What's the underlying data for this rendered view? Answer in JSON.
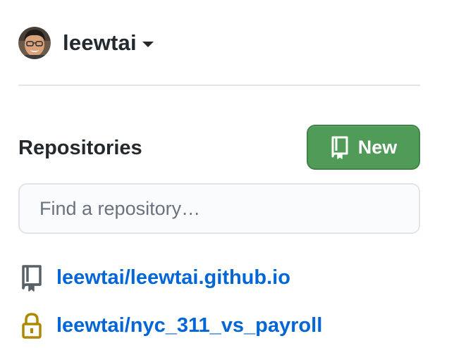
{
  "account": {
    "username": "leewtai",
    "avatar_icon": "user-avatar-photo",
    "dropdown_icon": "caret-down-icon"
  },
  "repositories": {
    "heading": "Repositories",
    "new_button": {
      "label": "New",
      "icon": "repo-icon",
      "color": "#4f9b57"
    },
    "search": {
      "placeholder": "Find a repository…",
      "value": ""
    },
    "items": [
      {
        "name": "leewtai/leewtai.github.io",
        "icon": "repo-icon",
        "visibility": "public"
      },
      {
        "name": "leewtai/nyc_311_vs_payroll",
        "icon": "lock-icon",
        "visibility": "private"
      }
    ]
  },
  "colors": {
    "link": "#0366d6",
    "private_lock": "#b08800",
    "text": "#24292e"
  }
}
